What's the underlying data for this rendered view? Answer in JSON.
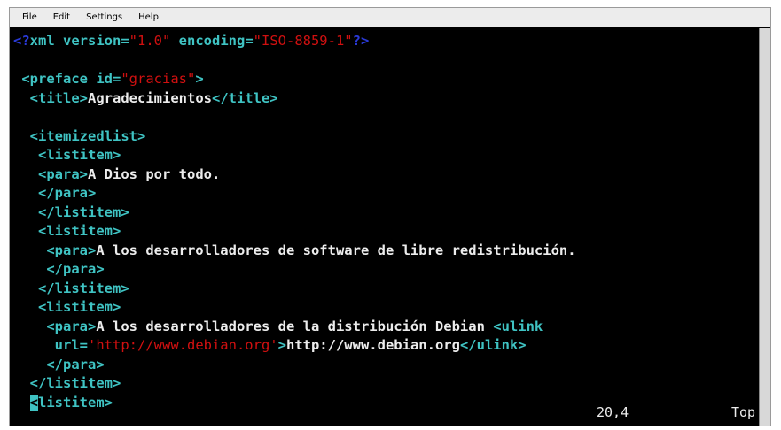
{
  "menubar": {
    "items": [
      "File",
      "Edit",
      "Settings",
      "Help"
    ]
  },
  "lines": [
    [
      {
        "c": "pi",
        "t": "<?"
      },
      {
        "c": "tag",
        "t": "xml version="
      },
      {
        "c": "str",
        "t": "\"1.0\""
      },
      {
        "c": "tag",
        "t": " encoding="
      },
      {
        "c": "str",
        "t": "\"ISO-8859-1\""
      },
      {
        "c": "pi",
        "t": "?>"
      }
    ],
    [],
    [
      {
        "c": "tag",
        "t": " <preface id="
      },
      {
        "c": "str",
        "t": "\"gracias\""
      },
      {
        "c": "tag",
        "t": ">"
      }
    ],
    [
      {
        "c": "tag",
        "t": "  <title>"
      },
      {
        "c": "txt",
        "t": "Agradecimientos"
      },
      {
        "c": "tag",
        "t": "</title>"
      }
    ],
    [],
    [
      {
        "c": "tag",
        "t": "  <itemizedlist>"
      }
    ],
    [
      {
        "c": "tag",
        "t": "   <listitem>"
      }
    ],
    [
      {
        "c": "tag",
        "t": "   <para>"
      },
      {
        "c": "txt",
        "t": "A Dios por todo."
      }
    ],
    [
      {
        "c": "tag",
        "t": "   </para>"
      }
    ],
    [
      {
        "c": "tag",
        "t": "   </listitem>"
      }
    ],
    [
      {
        "c": "tag",
        "t": "   <listitem>"
      }
    ],
    [
      {
        "c": "tag",
        "t": "    <para>"
      },
      {
        "c": "txt",
        "t": "A los desarrolladores de software de libre redistribución."
      }
    ],
    [
      {
        "c": "tag",
        "t": "    </para>"
      }
    ],
    [
      {
        "c": "tag",
        "t": "   </listitem>"
      }
    ],
    [
      {
        "c": "tag",
        "t": "   <listitem>"
      }
    ],
    [
      {
        "c": "tag",
        "t": "    <para>"
      },
      {
        "c": "txt",
        "t": "A los desarrolladores de la distribución Debian "
      },
      {
        "c": "tag",
        "t": "<ulink"
      }
    ],
    [
      {
        "c": "tag",
        "t": "     url="
      },
      {
        "c": "str",
        "t": "'http://www.debian.org'"
      },
      {
        "c": "tag",
        "t": ">"
      },
      {
        "c": "txt",
        "t": "http://www.debian.org"
      },
      {
        "c": "tag",
        "t": "</ulink>"
      }
    ],
    [
      {
        "c": "tag",
        "t": "    </para>"
      }
    ],
    [
      {
        "c": "tag",
        "t": "  </listitem>"
      }
    ],
    [
      {
        "c": "txt",
        "t": "  "
      },
      {
        "c": "cursor",
        "t": "<"
      },
      {
        "c": "tag",
        "t": "listitem>"
      }
    ]
  ],
  "status": {
    "position": "20,4",
    "scroll": "Top"
  }
}
